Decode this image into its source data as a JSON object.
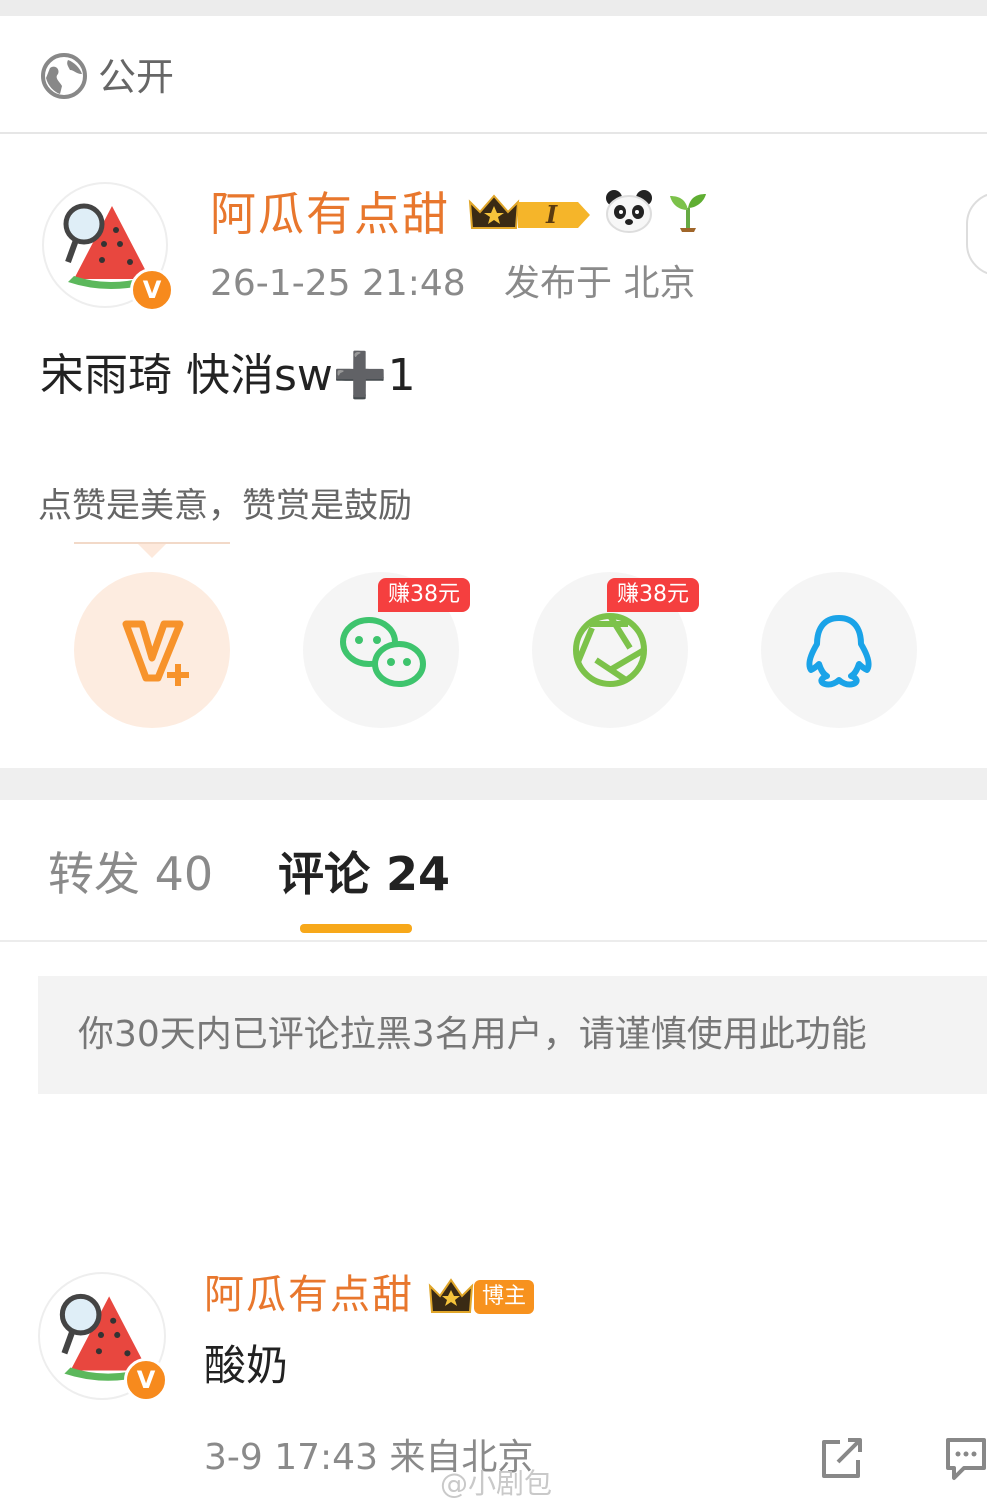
{
  "privacy": {
    "label": "公开",
    "icon": "globe-icon"
  },
  "post": {
    "username": "阿瓜有点甜",
    "date": "26-1-25 21:48",
    "location": "发布于 北京",
    "text": "宋雨琦 快消sw➕1",
    "level_badge": "I"
  },
  "reward": {
    "hint": "点赞是美意，赞赏是鼓励",
    "share_targets": [
      {
        "name": "weibo-vplus",
        "earn": ""
      },
      {
        "name": "wechat",
        "earn": "赚38元"
      },
      {
        "name": "moments",
        "earn": "赚38元"
      },
      {
        "name": "qq",
        "earn": ""
      }
    ]
  },
  "tabs": {
    "repost": "转发 40",
    "comment": "评论 24"
  },
  "notice": "你30天内已评论拉黑3名用户，请谨慎使用此功能",
  "comment": {
    "username": "阿瓜有点甜",
    "badge": "博主",
    "text": "酸奶",
    "meta": "3-9 17:43 来自北京"
  },
  "watermark": "@小剧包",
  "colors": {
    "accent_orange": "#e8772d",
    "tab_underline": "#f7a81a",
    "earn_badge": "#f53f3f",
    "wechat_green": "#3ec46d",
    "qq_blue": "#1aa3e8"
  }
}
